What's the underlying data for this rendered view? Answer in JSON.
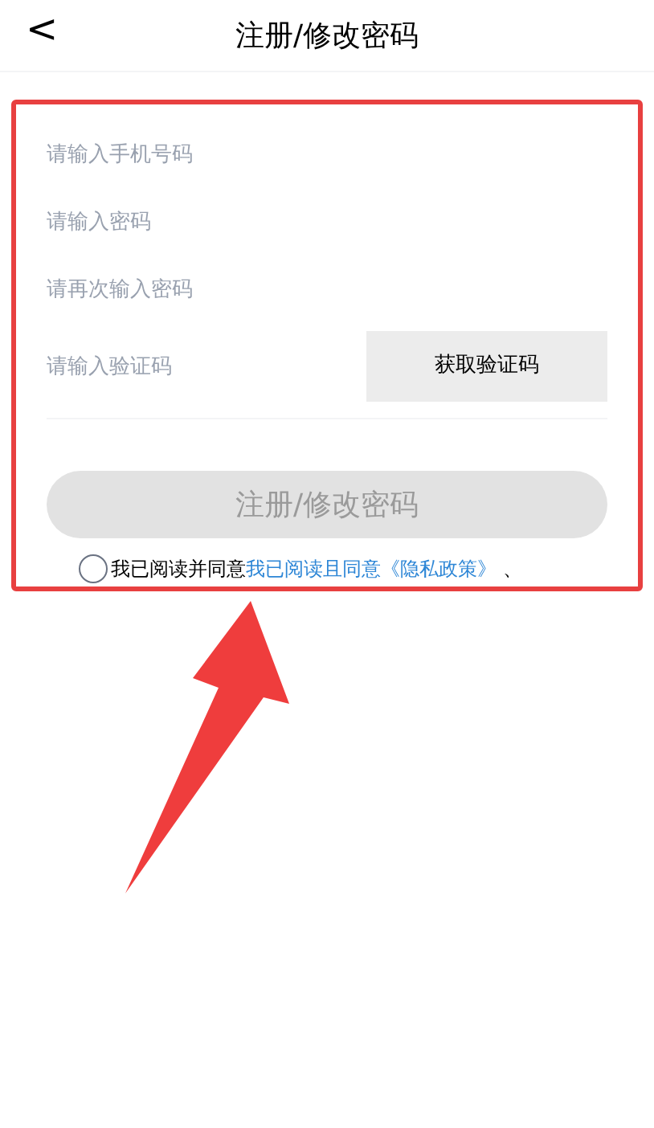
{
  "header": {
    "back_icon": "<",
    "title": "注册/修改密码"
  },
  "fields": [
    {
      "placeholder": "请输入手机号码"
    },
    {
      "placeholder": "请输入密码"
    },
    {
      "placeholder": "请再次输入密码"
    }
  ],
  "code_field": {
    "placeholder": "请输入验证码",
    "button": "获取验证码"
  },
  "submit": {
    "label": "注册/修改密码",
    "disabled": true
  },
  "agreement": {
    "checked": false,
    "text": "我已阅读并同意",
    "link": "我已阅读且同意《隐私政策》",
    "suffix": "、"
  },
  "annotation": {
    "kind": "highlight"
  }
}
